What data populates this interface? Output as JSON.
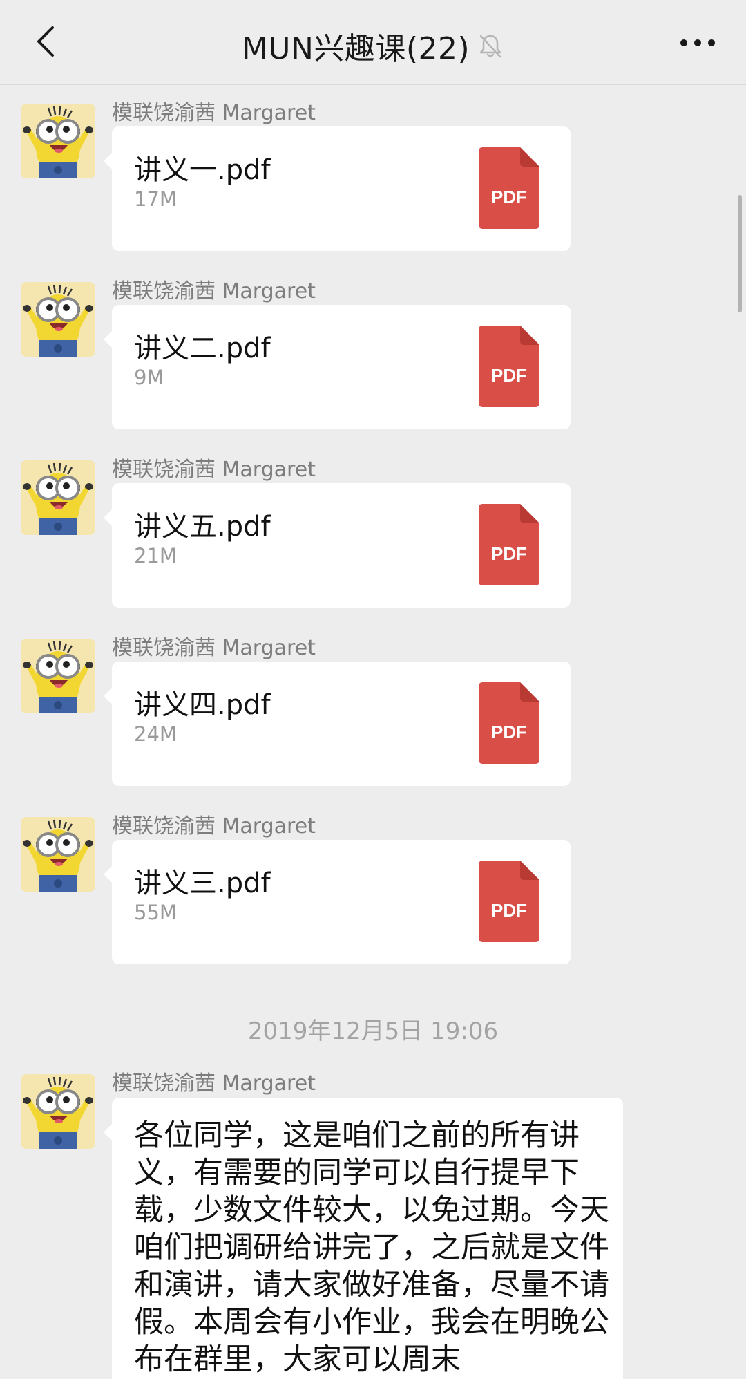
{
  "header": {
    "title": "MUN兴趣课(22)",
    "back_icon": "chevron-left-icon",
    "mute_icon": "bell-off-icon",
    "more_icon": "more-dots-icon"
  },
  "messages": [
    {
      "sender": "模联饶渝茜 Margaret",
      "file_name": "讲义一.pdf",
      "file_size": "17M",
      "file_type": "PDF"
    },
    {
      "sender": "模联饶渝茜 Margaret",
      "file_name": "讲义二.pdf",
      "file_size": "9M",
      "file_type": "PDF"
    },
    {
      "sender": "模联饶渝茜 Margaret",
      "file_name": "讲义五.pdf",
      "file_size": "21M",
      "file_type": "PDF"
    },
    {
      "sender": "模联饶渝茜 Margaret",
      "file_name": "讲义四.pdf",
      "file_size": "24M",
      "file_type": "PDF"
    },
    {
      "sender": "模联饶渝茜 Margaret",
      "file_name": "讲义三.pdf",
      "file_size": "55M",
      "file_type": "PDF"
    }
  ],
  "timestamp": "2019年12月5日 19:06",
  "text_message": {
    "sender": "模联饶渝茜 Margaret",
    "text": "各位同学，这是咱们之前的所有讲义，有需要的同学可以自行提早下载，少数文件较大，以免过期。今天咱们把调研给讲完了，之后就是文件和演讲，请大家做好准备，尽量不请假。本周会有小作业，我会在明晚公布在群里，大家可以周末"
  },
  "colors": {
    "background": "#ededed",
    "bubble": "#ffffff",
    "pdf_red": "#d94f48",
    "pdf_fold": "#b83a33"
  }
}
